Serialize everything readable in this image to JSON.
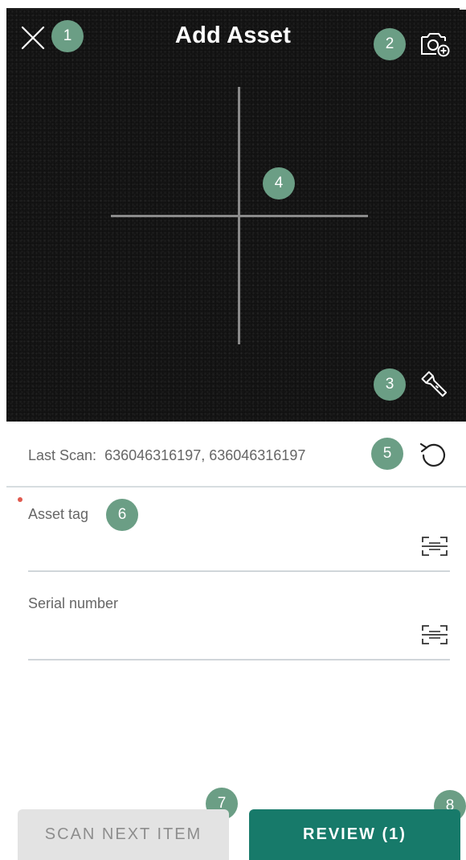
{
  "header": {
    "title": "Add Asset",
    "close_icon": "close-icon",
    "camera_icon": "camera-add-icon",
    "flash_icon": "flashlight-icon"
  },
  "last_scan": {
    "label": "Last Scan:",
    "value": "636046316197, 636046316197",
    "refresh_icon": "undo-icon"
  },
  "fields": [
    {
      "label": "Asset tag",
      "value": "",
      "required": true,
      "scan_icon": "barcode-scan-icon"
    },
    {
      "label": "Serial number",
      "value": "",
      "required": false,
      "scan_icon": "barcode-scan-icon"
    }
  ],
  "buttons": {
    "scan_next": "SCAN NEXT ITEM",
    "review": "REVIEW (1)"
  },
  "callouts": [
    "1",
    "2",
    "3",
    "4",
    "5",
    "6",
    "7",
    "8"
  ],
  "colors": {
    "camera_bg": "#151515",
    "badge": "#6b9e85",
    "primary": "#177a6a",
    "secondary_bg": "#e3e3e3",
    "required_dot": "#e05a4f"
  }
}
